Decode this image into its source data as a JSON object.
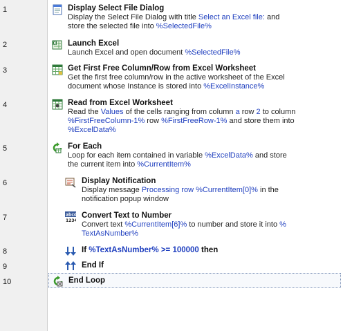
{
  "lines": [
    "1",
    "2",
    "3",
    "4",
    "5",
    "6",
    "7",
    "8",
    "9",
    "10"
  ],
  "steps": [
    {
      "title": "Display Select File Dialog",
      "d1": "Display the Select File Dialog with title ",
      "d1v": "Select an Excel file:",
      "d1b": " and",
      "d2": "store the selected file into ",
      "d2v": "%SelectedFile%"
    },
    {
      "title": "Launch Excel",
      "d1": "Launch Excel and open document ",
      "d1v": "%SelectedFile%"
    },
    {
      "title": "Get First Free Column/Row from Excel Worksheet",
      "d1": "Get the first free column/row in the active worksheet of the Excel",
      "d2": "document whose Instance is stored into ",
      "d2v": "%ExcelInstance%"
    },
    {
      "title": "Read from Excel Worksheet",
      "d1a": "Read the ",
      "d1v1": "Values",
      "d1b": " of the cells ranging from column ",
      "d1v2": "a",
      "d1c": " row ",
      "d1v3": "2",
      "d1d": " to column",
      "d2v1": "%FirstFreeColumn-1%",
      "d2a": " row ",
      "d2v2": "%FirstFreeRow-1%",
      "d2b": " and store them into",
      "d3v": "%ExcelData%"
    },
    {
      "title": "For Each",
      "d1": "Loop for each item contained in variable ",
      "d1v": "%ExcelData%",
      "d1b": " and store",
      "d2": "the current item into ",
      "d2v": "%CurrentItem%"
    },
    {
      "title": "Display Notification",
      "d1": "Display message ",
      "d1v": "Processing row %CurrentItem[0]%",
      "d1b": " in the",
      "d2": "notification popup window"
    },
    {
      "title": "Convert Text to Number",
      "d1": "Convert text ",
      "d1v": "%CurrentItem[6]%",
      "d1b": " to number and store it into ",
      "d1v2": "%",
      "d2v": "TextAsNumber%"
    },
    {
      "t_if": "If ",
      "t_v": "%TextAsNumber% >= 100000",
      "t_then": " then"
    },
    {
      "title": "End If"
    },
    {
      "title": "End Loop"
    }
  ],
  "icons": [
    "select-file-dialog-icon",
    "launch-excel-icon",
    "excel-free-cell-icon",
    "read-excel-icon",
    "for-each-icon",
    "notification-icon",
    "convert-text-number-icon",
    "if-icon",
    "end-if-icon",
    "end-loop-icon"
  ],
  "colors": {
    "variable": "#1f3fbf",
    "gutter": "#f0f0f0",
    "selection_border": "#7a8fb5"
  }
}
